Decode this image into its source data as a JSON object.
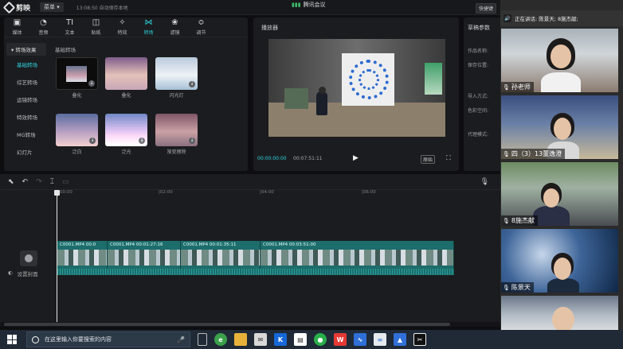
{
  "app": {
    "name": "剪映",
    "menu_label": "菜单",
    "autosave": "13:08:50 自动保存本地",
    "shortcut_label": "快捷键"
  },
  "meeting": {
    "title": "腾讯会议",
    "speaking_label": "正在讲话: 陈景天; 8施杰献;"
  },
  "toolbar": [
    {
      "icon": "media-icon",
      "glyph": "▣",
      "label": "媒体"
    },
    {
      "icon": "audio-icon",
      "glyph": "◔",
      "label": "音频"
    },
    {
      "icon": "text-icon",
      "glyph": "TI",
      "label": "文本"
    },
    {
      "icon": "sticker-icon",
      "glyph": "◫",
      "label": "贴纸"
    },
    {
      "icon": "effects-icon",
      "glyph": "✧",
      "label": "特效"
    },
    {
      "icon": "transition-icon",
      "glyph": "⋈",
      "label": "转场"
    },
    {
      "icon": "filter-icon",
      "glyph": "❀",
      "label": "滤镜"
    },
    {
      "icon": "adjust-icon",
      "glyph": "≎",
      "label": "调节"
    }
  ],
  "categories": {
    "header": "▾ 转场效果",
    "items": [
      "基础转场",
      "综艺转场",
      "运镜转场",
      "特效转场",
      "MG转场",
      "幻灯片"
    ]
  },
  "transitions": {
    "section_title": "基础转场",
    "items": [
      {
        "label": "叠化",
        "download": false
      },
      {
        "label": "叠化",
        "download": false
      },
      {
        "label": "闪光灯",
        "download": true
      },
      {
        "label": "泛白",
        "download": true
      },
      {
        "label": "泛光",
        "download": true
      },
      {
        "label": "渐变擦除",
        "download": true
      }
    ]
  },
  "player": {
    "title": "播放器",
    "current_time": "00:00:00:00",
    "total_time": "00:07:51:11",
    "ratio_label": "原始"
  },
  "draft": {
    "title": "草稿参数",
    "rows": [
      "作品名称:",
      "保存位置:",
      "导入方式:",
      "色彩空间:",
      "代理模式:"
    ]
  },
  "timeline": {
    "ruler": [
      "00:00",
      "|02:00",
      "|04:00",
      "|06:00"
    ],
    "cover_label": "设置封面",
    "clips": [
      {
        "name": "C0001.MP4   00:0"
      },
      {
        "name": "C0001.MP4   00:01:27:16"
      },
      {
        "name": "C0001.MP4   00:01:35:11"
      },
      {
        "name": "C0001.MP4   00:03:51:00"
      }
    ]
  },
  "participants": [
    {
      "name": "孙老师"
    },
    {
      "name": "四（3）13董逸澄"
    },
    {
      "name": "8施杰献"
    },
    {
      "name": "陈景天"
    },
    {
      "name": ""
    }
  ],
  "taskbar": {
    "search_placeholder": "在这里输入你要搜索的内容"
  }
}
